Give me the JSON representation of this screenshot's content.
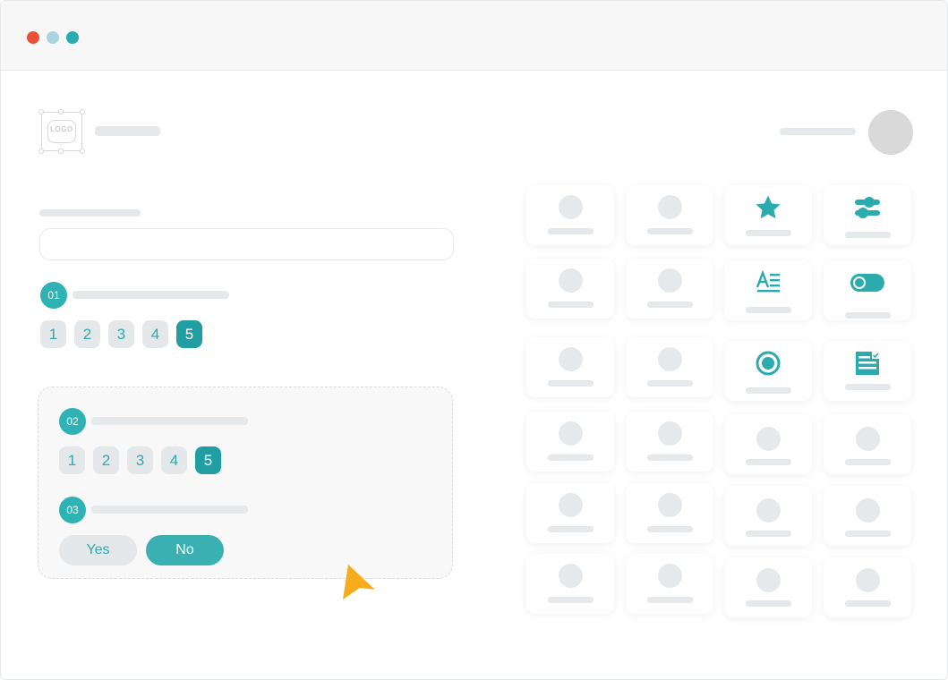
{
  "window": {
    "controls": [
      {
        "name": "close",
        "color": "#e8523a"
      },
      {
        "name": "minimize",
        "color": "#a9d5e0"
      },
      {
        "name": "maximize",
        "color": "#2aabad"
      }
    ]
  },
  "header": {
    "logo_text": "LOGO"
  },
  "colors": {
    "accent": "#2fb2b4",
    "accent_dark": "#219ea2",
    "cursor": "#f7ac1e",
    "placeholder": "#e6e9ec"
  },
  "form": {
    "question1": {
      "number": "01",
      "options": [
        "1",
        "2",
        "3",
        "4",
        "5"
      ],
      "selected": "5"
    },
    "question2": {
      "number": "02",
      "options": [
        "1",
        "2",
        "3",
        "4",
        "5"
      ],
      "selected": "5"
    },
    "question3": {
      "number": "03",
      "yes_label": "Yes",
      "no_label": "No",
      "selected": "No"
    }
  },
  "palette": {
    "icons": [
      "star-icon",
      "sliders-icon",
      "text-format-icon",
      "toggle-icon",
      "radio-icon",
      "form-icon"
    ]
  }
}
